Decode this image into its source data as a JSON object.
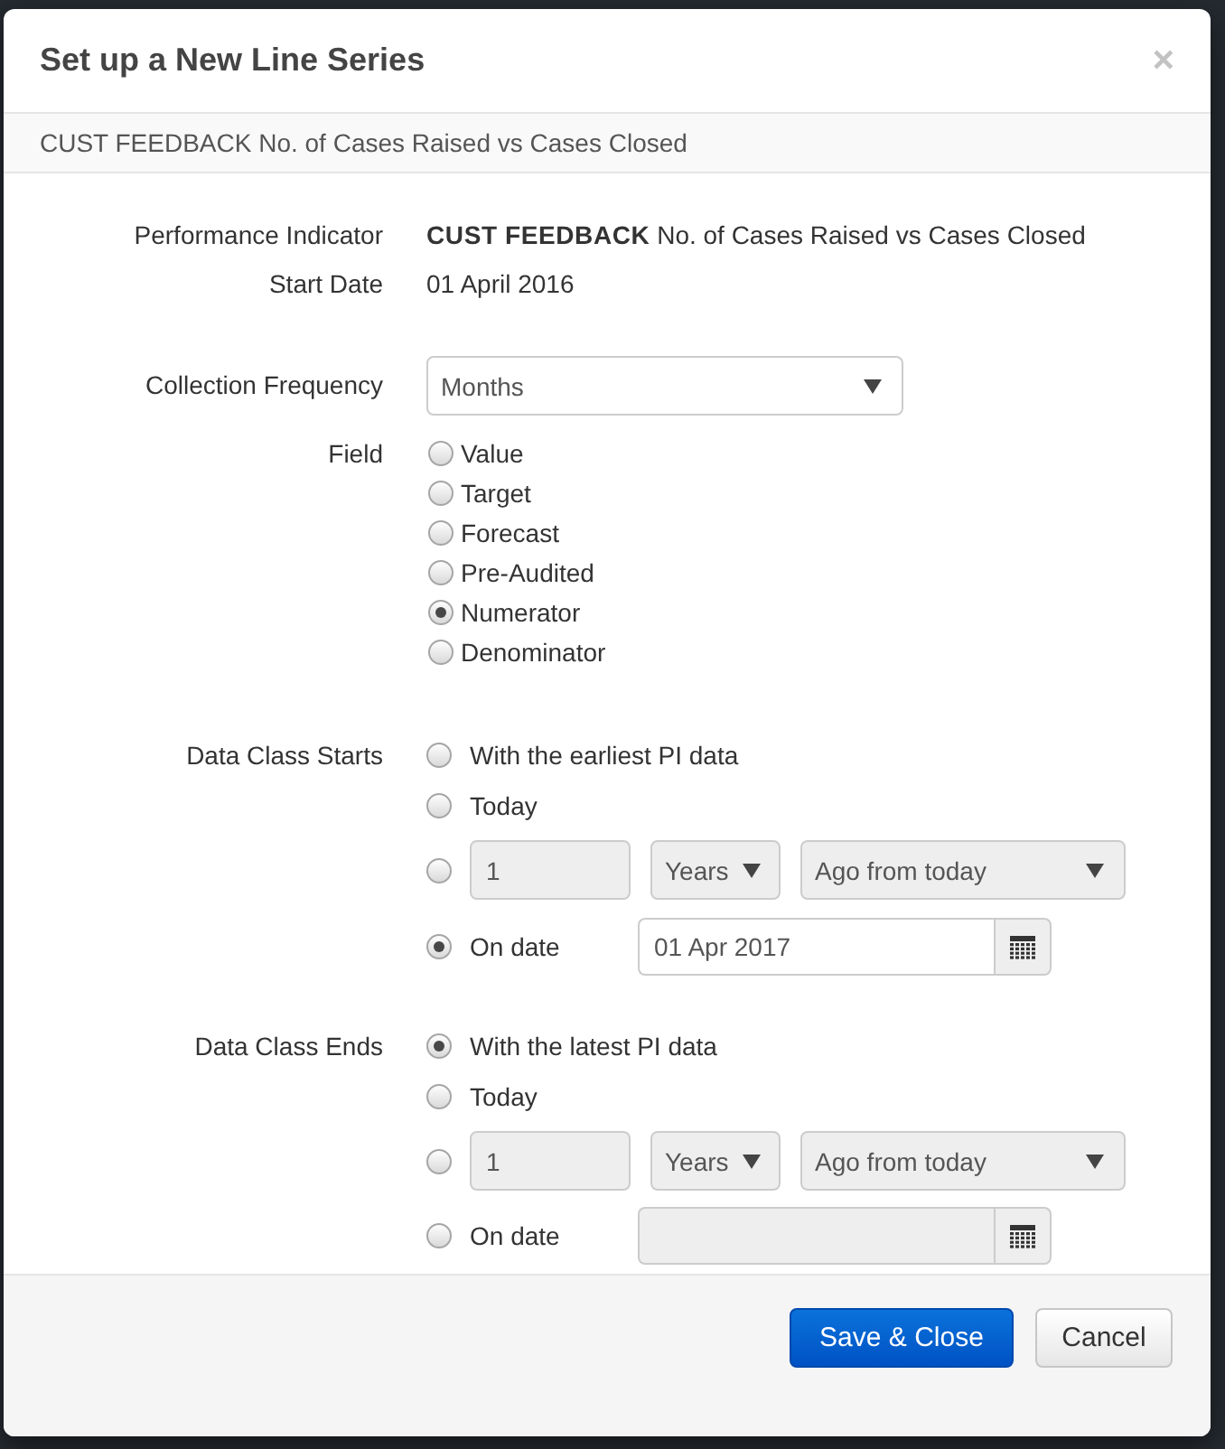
{
  "dialog": {
    "title": "Set up a New Line Series",
    "close": "×"
  },
  "subtitle": "CUST FEEDBACK No. of Cases Raised vs Cases Closed",
  "details": [
    {
      "label": "Performance Indicator",
      "value": "**CUST FEEDBACK** No. of Cases Raised vs Cases Closed"
    },
    {
      "label": "Start Date",
      "value": "01 April 2016"
    }
  ],
  "collection_frequency": {
    "label": "Collection Frequency",
    "value": "Months"
  },
  "field": {
    "label": "Field",
    "options": [
      {
        "label": "Value",
        "selected": false
      },
      {
        "label": "Target",
        "selected": false
      },
      {
        "label": "Forecast",
        "selected": false
      },
      {
        "label": "Pre-Audited",
        "selected": false
      },
      {
        "label": "Numerator",
        "selected": true
      },
      {
        "label": "Denominator",
        "selected": false
      }
    ]
  },
  "data_class_starts": {
    "label": "Data Class Starts",
    "options": [
      {
        "kind": "text",
        "label": "With the earliest PI data",
        "selected": false
      },
      {
        "kind": "text",
        "label": "Today",
        "selected": false
      },
      {
        "kind": "offset",
        "amount": "1",
        "unit": "Years",
        "direction": "Ago from today",
        "selected": false
      },
      {
        "kind": "date",
        "label": "On date",
        "value": "01 Apr 2017",
        "selected": true
      }
    ]
  },
  "data_class_ends": {
    "label": "Data Class Ends",
    "options": [
      {
        "kind": "text",
        "label": "With the latest PI data",
        "selected": true
      },
      {
        "kind": "text",
        "label": "Today",
        "selected": false
      },
      {
        "kind": "offset",
        "amount": "1",
        "unit": "Years",
        "direction": "Ago from today",
        "selected": false
      },
      {
        "kind": "date",
        "label": "On date",
        "selected": false
      }
    ]
  },
  "buttons": [
    {
      "kind": "primary",
      "label": "Save & Close"
    },
    {
      "kind": "default",
      "label": "Cancel"
    }
  ]
}
